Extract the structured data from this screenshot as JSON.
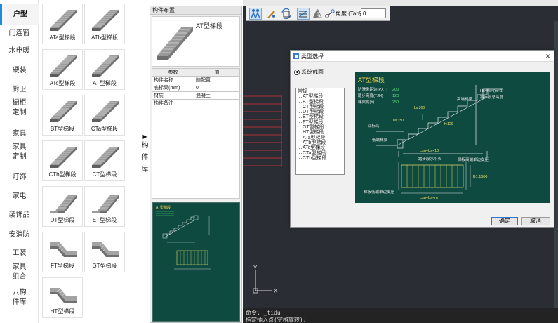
{
  "category_rail": {
    "items": [
      {
        "label": "户型",
        "active": true
      },
      {
        "label": "门连窗"
      },
      {
        "label": "水电暖"
      },
      {
        "label": "硬装"
      },
      {
        "label": "厨卫"
      },
      {
        "label": "橱柜定制"
      },
      {
        "label": "家具"
      },
      {
        "label": "家具定制"
      },
      {
        "label": "灯饰"
      },
      {
        "label": "家电"
      },
      {
        "label": "装饰品"
      },
      {
        "label": "安消防"
      },
      {
        "label": "工装"
      },
      {
        "label": "家具组合"
      },
      {
        "label": "云构件库"
      }
    ]
  },
  "component_grid": {
    "tiles": [
      {
        "label": "ATa型梯段",
        "icon": "straight-stair-icon"
      },
      {
        "label": "ATb型梯段",
        "icon": "straight-stair-icon"
      },
      {
        "label": "ATc型梯段",
        "icon": "straight-stair-icon"
      },
      {
        "label": "AT型梯段",
        "icon": "straight-stair-icon"
      },
      {
        "label": "BT型梯段",
        "icon": "straight-stair-icon"
      },
      {
        "label": "CTa型梯段",
        "icon": "straight-stair-icon"
      },
      {
        "label": "CTb型梯段",
        "icon": "straight-stair-icon"
      },
      {
        "label": "CT型梯段",
        "icon": "straight-stair-icon"
      },
      {
        "label": "DT型梯段",
        "icon": "landing-stair-icon"
      },
      {
        "label": "ET型梯段",
        "icon": "landing-stair-icon"
      },
      {
        "label": "FT型梯段",
        "icon": "folded-stair-icon"
      },
      {
        "label": "GT型梯段",
        "icon": "folded-stair-icon"
      },
      {
        "label": "HT型梯段",
        "icon": "folded-stair-icon"
      }
    ]
  },
  "library_toggle": {
    "arrow": "▶",
    "chars": [
      "构",
      "件",
      "库"
    ]
  },
  "layout_panel": {
    "title": "构件布置",
    "preview_name": "AT型梯段",
    "table": {
      "headers": [
        "参数",
        "值"
      ],
      "rows": [
        [
          "构件名称",
          "随配置"
        ],
        [
          "底标高(mm)",
          "0"
        ],
        [
          "材质",
          "混凝土"
        ],
        [
          "构件备注",
          ""
        ]
      ]
    },
    "thumb_title": "AT型梯段"
  },
  "cad": {
    "toolbar": {
      "buttons": [
        {
          "icon": "dual-person-icon",
          "active": true
        },
        {
          "icon": "pen-edit-icon"
        },
        {
          "icon": "rotate-flip-icon"
        },
        {
          "icon": "stair-align-icon",
          "active": true
        },
        {
          "icon": "mirror-triangle-icon"
        },
        {
          "icon": "node-connect-icon"
        }
      ],
      "angle_label": "角度 (Tab键):",
      "angle_value": "0"
    },
    "axis": {
      "y_label": "Y",
      "x_label": "X"
    },
    "command_lines": [
      "命令: _tidu",
      "指定插入点(空格旋转):"
    ],
    "colors": {
      "background": "#2a2e34",
      "red_lines": "#d8353a"
    }
  },
  "dialog": {
    "title": "类型选择",
    "close": "×",
    "radio_label": "系统截面",
    "tree": {
      "root": "常规",
      "items": [
        "AT型梯段",
        "BT型梯段",
        "CT型梯段",
        "DT型梯段",
        "ET型梯段",
        "FT型梯段",
        "GT型梯段",
        "HT型梯段",
        "ATa型梯段",
        "ATb型梯段",
        "ATc型梯段",
        "CTa型梯段",
        "CTb型梯段"
      ]
    },
    "figure": {
      "title": "AT型梯段",
      "spec_labels": [
        "防滑条距边(PXT)",
        "踏步高度(TJH)",
        "梯梁宽(b)"
      ],
      "spec_values": [
        "200",
        "120",
        "250"
      ],
      "labels": {
        "high_beam": "高端梯梁",
        "total_height": "Hs=hs×(m+1)",
        "total_height_desc": "踏步段总高度",
        "floor_level": "底标高",
        "low_beam": "低端梯梁",
        "step_width": "bs:300",
        "riser": "hs:150",
        "thickness": "h:120",
        "run_formula": "Lsn=bs×10",
        "run_desc": "踏步段水平长",
        "high_support": "梯板高端单边支座",
        "low_support": "梯板低端单边支座",
        "plan_width": "B1:1500",
        "plan_run": "Lsn=bs×m"
      },
      "colors": {
        "bg": "#0e4a40",
        "line": "#e8e8e8",
        "green": "#58e07a",
        "yellow": "#e6e06a",
        "cyan": "#7fe6e6",
        "title": "#ffd84a"
      }
    },
    "buttons": {
      "ok": "确定",
      "cancel": "取消"
    }
  }
}
